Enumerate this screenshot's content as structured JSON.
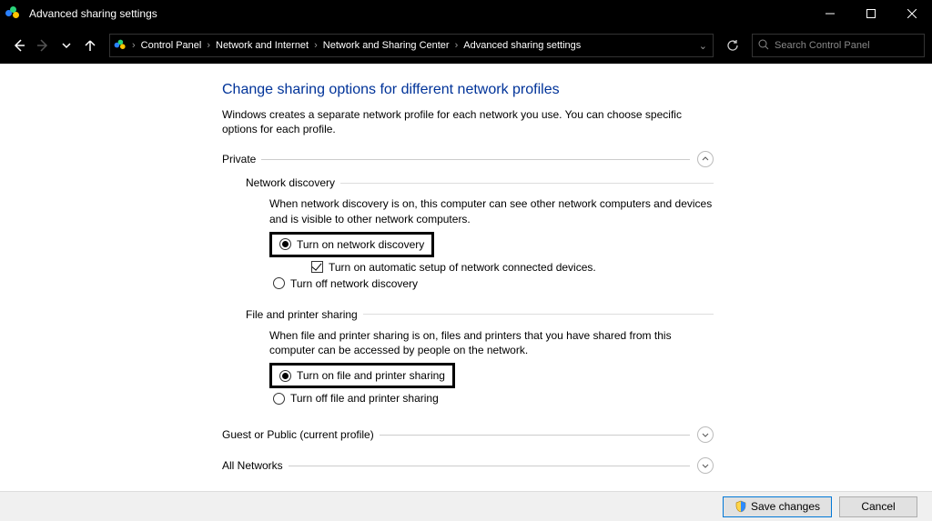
{
  "window": {
    "title": "Advanced sharing settings"
  },
  "breadcrumb": {
    "items": [
      "Control Panel",
      "Network and Internet",
      "Network and Sharing Center",
      "Advanced sharing settings"
    ]
  },
  "search": {
    "placeholder": "Search Control Panel"
  },
  "page": {
    "title": "Change sharing options for different network profiles",
    "description": "Windows creates a separate network profile for each network you use. You can choose specific options for each profile."
  },
  "private": {
    "label": "Private",
    "discovery": {
      "label": "Network discovery",
      "desc": "When network discovery is on, this computer can see other network computers and devices and is visible to other network computers.",
      "opt_on": "Turn on network discovery",
      "opt_auto": "Turn on automatic setup of network connected devices.",
      "opt_off": "Turn off network discovery"
    },
    "fileprint": {
      "label": "File and printer sharing",
      "desc": "When file and printer sharing is on, files and printers that you have shared from this computer can be accessed by people on the network.",
      "opt_on": "Turn on file and printer sharing",
      "opt_off": "Turn off file and printer sharing"
    }
  },
  "guest": {
    "label": "Guest or Public (current profile)"
  },
  "allnet": {
    "label": "All Networks"
  },
  "buttons": {
    "save": "Save changes",
    "cancel": "Cancel"
  }
}
